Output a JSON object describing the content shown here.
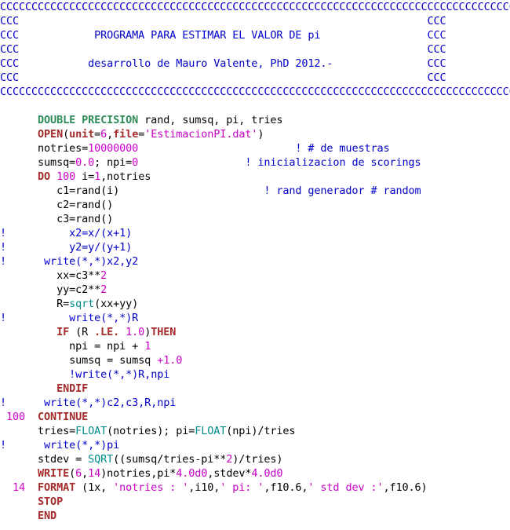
{
  "editor": {
    "language": "Fortran",
    "colors": {
      "comment": "#0000c8",
      "statement": "#a52a2a",
      "type": "#2e8b57",
      "constant": "#c800c8",
      "function": "#008b8b",
      "text": "#000000",
      "background": "#ffffff"
    },
    "lines": [
      [
        {
          "c": "c",
          "t": "CCCCCCCCCCCCCCCCCCCCCCCCCCCCCCCCCCCCCCCCCCCCCCCCCCCCCCCCCCCCCCCCCCCCCCCCCCCCCCCCCCCCCCCC"
        }
      ],
      [
        {
          "c": "c",
          "t": "CCC                                                                 CCC"
        }
      ],
      [
        {
          "c": "c",
          "t": "CCC            PROGRAMA PARA ESTIMAR EL VALOR DE pi                 CCC"
        }
      ],
      [
        {
          "c": "c",
          "t": "CCC                                                                 CCC"
        }
      ],
      [
        {
          "c": "c",
          "t": "CCC           desarrollo de Mauro Valente, PhD 2012.-               CCC"
        }
      ],
      [
        {
          "c": "c",
          "t": "CCC                                                                 CCC"
        }
      ],
      [
        {
          "c": "c",
          "t": "CCCCCCCCCCCCCCCCCCCCCCCCCCCCCCCCCCCCCCCCCCCCCCCCCCCCCCCCCCCCCCCCCCCCCCCCCCCCCCCCCCCCCCCC"
        }
      ],
      [],
      [
        {
          "c": "id",
          "t": "      "
        },
        {
          "c": "t",
          "t": "DOUBLE PRECISION"
        },
        {
          "c": "id",
          "t": " rand, sumsq, pi, tries"
        }
      ],
      [
        {
          "c": "id",
          "t": "      "
        },
        {
          "c": "k",
          "t": "OPEN"
        },
        {
          "c": "id",
          "t": "("
        },
        {
          "c": "k",
          "t": "unit"
        },
        {
          "c": "id",
          "t": "="
        },
        {
          "c": "n",
          "t": "6"
        },
        {
          "c": "id",
          "t": ","
        },
        {
          "c": "k",
          "t": "file"
        },
        {
          "c": "id",
          "t": "="
        },
        {
          "c": "n",
          "t": "'EstimacionPI.dat'"
        },
        {
          "c": "id",
          "t": ")"
        }
      ],
      [
        {
          "c": "id",
          "t": "      notries="
        },
        {
          "c": "n",
          "t": "10000000"
        },
        {
          "c": "id",
          "t": "                         "
        },
        {
          "c": "c",
          "t": "! # de muestras"
        }
      ],
      [
        {
          "c": "id",
          "t": "      sumsq="
        },
        {
          "c": "n",
          "t": "0.0"
        },
        {
          "c": "id",
          "t": "; npi="
        },
        {
          "c": "n",
          "t": "0"
        },
        {
          "c": "id",
          "t": "                 "
        },
        {
          "c": "c",
          "t": "! inicializacion de scorings"
        }
      ],
      [
        {
          "c": "id",
          "t": "      "
        },
        {
          "c": "k",
          "t": "DO"
        },
        {
          "c": "id",
          "t": " "
        },
        {
          "c": "n",
          "t": "100"
        },
        {
          "c": "id",
          "t": " i="
        },
        {
          "c": "n",
          "t": "1"
        },
        {
          "c": "id",
          "t": ",notries"
        }
      ],
      [
        {
          "c": "id",
          "t": "         c1=rand(i)                       "
        },
        {
          "c": "c",
          "t": "! rand generador # random"
        }
      ],
      [
        {
          "c": "id",
          "t": "         c2=rand()"
        }
      ],
      [
        {
          "c": "id",
          "t": "         c3=rand()"
        }
      ],
      [
        {
          "c": "c",
          "t": "!          x2=x/(x+1)"
        }
      ],
      [
        {
          "c": "c",
          "t": "!          y2=y/(y+1)"
        }
      ],
      [
        {
          "c": "c",
          "t": "!      write(*,*)x2,y2"
        }
      ],
      [
        {
          "c": "id",
          "t": "         xx=c3**"
        },
        {
          "c": "n",
          "t": "2"
        }
      ],
      [
        {
          "c": "id",
          "t": "         yy=c2**"
        },
        {
          "c": "n",
          "t": "2"
        }
      ],
      [
        {
          "c": "id",
          "t": "         R="
        },
        {
          "c": "f",
          "t": "sqrt"
        },
        {
          "c": "id",
          "t": "(xx+yy)"
        }
      ],
      [
        {
          "c": "c",
          "t": "!          write(*,*)R"
        }
      ],
      [
        {
          "c": "id",
          "t": "         "
        },
        {
          "c": "k",
          "t": "IF"
        },
        {
          "c": "id",
          "t": " (R "
        },
        {
          "c": "k",
          "t": ".LE."
        },
        {
          "c": "id",
          "t": " "
        },
        {
          "c": "n",
          "t": "1.0"
        },
        {
          "c": "id",
          "t": ")"
        },
        {
          "c": "k",
          "t": "THEN"
        }
      ],
      [
        {
          "c": "id",
          "t": "           npi = npi + "
        },
        {
          "c": "n",
          "t": "1"
        }
      ],
      [
        {
          "c": "id",
          "t": "           sumsq = sumsq "
        },
        {
          "c": "n",
          "t": "+1.0"
        }
      ],
      [
        {
          "c": "id",
          "t": "           "
        },
        {
          "c": "c",
          "t": "!write(*,*)R,npi"
        }
      ],
      [
        {
          "c": "id",
          "t": "         "
        },
        {
          "c": "k",
          "t": "ENDIF"
        }
      ],
      [
        {
          "c": "c",
          "t": "!      write(*,*)c2,c3,R,npi"
        }
      ],
      [
        {
          "c": "n",
          "t": " 100"
        },
        {
          "c": "id",
          "t": "  "
        },
        {
          "c": "k",
          "t": "CONTINUE"
        }
      ],
      [
        {
          "c": "id",
          "t": "      tries="
        },
        {
          "c": "f",
          "t": "FLOAT"
        },
        {
          "c": "id",
          "t": "(notries); pi="
        },
        {
          "c": "f",
          "t": "FLOAT"
        },
        {
          "c": "id",
          "t": "(npi)/tries"
        }
      ],
      [
        {
          "c": "c",
          "t": "!      write(*,*)pi"
        }
      ],
      [
        {
          "c": "id",
          "t": "      stdev = "
        },
        {
          "c": "f",
          "t": "SQRT"
        },
        {
          "c": "id",
          "t": "((sumsq/tries-pi**"
        },
        {
          "c": "n",
          "t": "2"
        },
        {
          "c": "id",
          "t": ")/tries)"
        }
      ],
      [
        {
          "c": "id",
          "t": "      "
        },
        {
          "c": "k",
          "t": "WRITE"
        },
        {
          "c": "id",
          "t": "("
        },
        {
          "c": "n",
          "t": "6"
        },
        {
          "c": "id",
          "t": ","
        },
        {
          "c": "n",
          "t": "14"
        },
        {
          "c": "id",
          "t": ")notries,pi*"
        },
        {
          "c": "n",
          "t": "4.0d0"
        },
        {
          "c": "id",
          "t": ",stdev*"
        },
        {
          "c": "n",
          "t": "4.0d0"
        }
      ],
      [
        {
          "c": "n",
          "t": "  14"
        },
        {
          "c": "id",
          "t": "  "
        },
        {
          "c": "k",
          "t": "FORMAT"
        },
        {
          "c": "id",
          "t": " (1x, "
        },
        {
          "c": "n",
          "t": "'notries : '"
        },
        {
          "c": "id",
          "t": ",i10,"
        },
        {
          "c": "n",
          "t": "' pi: '"
        },
        {
          "c": "id",
          "t": ",f10.6,"
        },
        {
          "c": "n",
          "t": "' std dev :'"
        },
        {
          "c": "id",
          "t": ",f10.6)"
        }
      ],
      [
        {
          "c": "id",
          "t": "      "
        },
        {
          "c": "k",
          "t": "STOP"
        }
      ],
      [
        {
          "c": "id",
          "t": "      "
        },
        {
          "c": "k",
          "t": "END"
        }
      ]
    ]
  }
}
